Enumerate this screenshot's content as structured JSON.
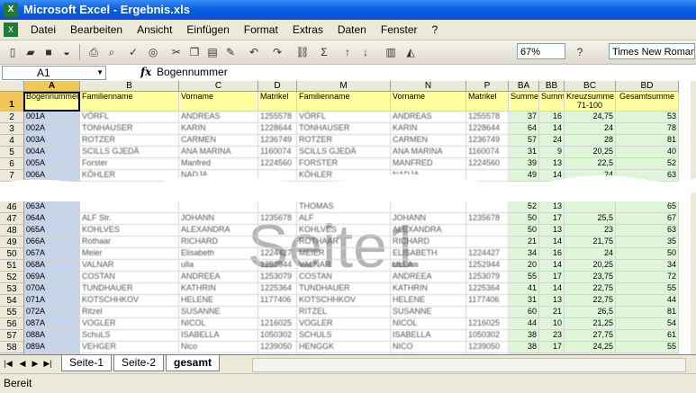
{
  "window": {
    "title": "Microsoft Excel - Ergebnis.xls"
  },
  "menu": [
    "Datei",
    "Bearbeiten",
    "Ansicht",
    "Einfügen",
    "Format",
    "Extras",
    "Daten",
    "Fenster",
    "?"
  ],
  "toolbar": {
    "zoom": "67%",
    "font": "Times New Roman"
  },
  "formula": {
    "cell_ref": "A1",
    "fx": "fx",
    "value": "Bogennummer"
  },
  "columns": [
    {
      "letter": "A",
      "w": 62
    },
    {
      "letter": "B",
      "w": 110
    },
    {
      "letter": "C",
      "w": 88
    },
    {
      "letter": "D",
      "w": 43
    },
    {
      "letter": "M",
      "w": 104
    },
    {
      "letter": "N",
      "w": 84
    },
    {
      "letter": "P",
      "w": 47
    },
    {
      "letter": "BA",
      "w": 34
    },
    {
      "letter": "BB",
      "w": 28
    },
    {
      "letter": "BC",
      "w": 57
    },
    {
      "letter": "BD",
      "w": 70
    }
  ],
  "header_row": [
    "Bogennummer",
    "Familienname",
    "Vorname",
    "Matrikel",
    "Familienname",
    "Vorname",
    "Matrikel",
    "Summe",
    "Summe",
    "Kreuzsumme 71-100",
    "Gesamtsumme"
  ],
  "rows": [
    {
      "n": "2",
      "c": [
        "001A",
        "VÖRFL",
        "ANDREAS",
        "1255578",
        "VÖRFL",
        "ANDREAS",
        "1255578",
        "37",
        "16",
        "24,75",
        "53"
      ]
    },
    {
      "n": "3",
      "c": [
        "002A",
        "TONHAUSER",
        "KARIN",
        "1228644",
        "TONHAUSER",
        "KARIN",
        "1228644",
        "64",
        "14",
        "24",
        "78"
      ]
    },
    {
      "n": "4",
      "c": [
        "003A",
        "ROTZER",
        "CARMEN",
        "1236749",
        "ROTZER",
        "CARMEN",
        "1236749",
        "57",
        "24",
        "28",
        "81"
      ]
    },
    {
      "n": "5",
      "c": [
        "004A",
        "SCILLS GJEDÄ",
        "ANA MARINA",
        "1160074",
        "SCILLS GJEDÄ",
        "ANA MARINA",
        "1160074",
        "31",
        "9",
        "20,25",
        "40"
      ]
    },
    {
      "n": "6",
      "c": [
        "005A",
        "Forster",
        "Manfred",
        "1224560",
        "FORSTER",
        "MANFRED",
        "1224560",
        "39",
        "13",
        "22,5",
        "52"
      ]
    },
    {
      "n": "7",
      "c": [
        "006A",
        "KÖHLER",
        "NADJA",
        "",
        "KÖHLER",
        "NADJA",
        "",
        "49",
        "14",
        "24",
        "63"
      ]
    },
    {
      "n": "46",
      "c": [
        "063A",
        "",
        "",
        "",
        "THOMAS",
        "",
        "",
        "52",
        "13",
        "",
        "65"
      ]
    },
    {
      "n": "47",
      "c": [
        "064A",
        "ALF Str.",
        "JOHANN",
        "1235678",
        "ALF",
        "JOHANN",
        "1235678",
        "50",
        "17",
        "25,5",
        "67"
      ]
    },
    {
      "n": "48",
      "c": [
        "065A",
        "KOHLVES",
        "ALEXANDRA",
        "",
        "KOHLVES",
        "ALEXANDRA",
        "",
        "50",
        "13",
        "23",
        "63"
      ]
    },
    {
      "n": "49",
      "c": [
        "066A",
        "Rothaar",
        "RICHARD",
        "",
        "ROTHAAR",
        "RICHARD",
        "",
        "21",
        "14",
        "21,75",
        "35"
      ]
    },
    {
      "n": "50",
      "c": [
        "067A",
        "Meier",
        "Elisabeth",
        "1224427",
        "MEIER",
        "ELISABETH",
        "1224427",
        "34",
        "16",
        "24",
        "50"
      ]
    },
    {
      "n": "51",
      "c": [
        "068A",
        "VALNAR",
        "ulla",
        "1252944",
        "VALNAR",
        "ULLA",
        "1252944",
        "20",
        "14",
        "20,25",
        "34"
      ]
    },
    {
      "n": "52",
      "c": [
        "069A",
        "COSTAN",
        "ANDREEA",
        "1253079",
        "COSTAN",
        "ANDREEA",
        "1253079",
        "55",
        "17",
        "23,75",
        "72"
      ]
    },
    {
      "n": "53",
      "c": [
        "070A",
        "TUNDHAUER",
        "KATHRIN",
        "1225364",
        "TUNDHAUER",
        "KATHRIN",
        "1225364",
        "41",
        "14",
        "22,75",
        "55"
      ]
    },
    {
      "n": "54",
      "c": [
        "071A",
        "KOTSCHHKOV",
        "HELENE",
        "1177406",
        "KOTSCHHKOV",
        "HELENE",
        "1177406",
        "31",
        "13",
        "22,75",
        "44"
      ]
    },
    {
      "n": "55",
      "c": [
        "072A",
        "Ritzel",
        "SUSANNE",
        "",
        "RITZEL",
        "SUSANNE",
        "",
        "60",
        "21",
        "26,5",
        "81"
      ]
    },
    {
      "n": "56",
      "c": [
        "087A",
        "VOGLER",
        "NICOL",
        "1216025",
        "VOGLER",
        "NICOL",
        "1216025",
        "44",
        "10",
        "21,25",
        "54"
      ]
    },
    {
      "n": "57",
      "c": [
        "088A",
        "SchuLS",
        "ISABELLA",
        "1050302",
        "SCHULS",
        "ISABELLA",
        "1050302",
        "38",
        "23",
        "27,75",
        "61"
      ]
    },
    {
      "n": "58",
      "c": [
        "089A",
        "VEHGER",
        "Nico",
        "1239050",
        "HENGGK",
        "NICO",
        "1239050",
        "38",
        "17",
        "24,25",
        "55"
      ]
    },
    {
      "n": "59",
      "c": [
        "090A",
        "PALLI",
        "RALF",
        "125558",
        "PALLI",
        "RALF",
        "125558",
        "54",
        "20",
        "27",
        "74"
      ]
    },
    {
      "n": "60",
      "c": [
        "091A",
        "JAHN",
        "MARTIN",
        "1243866",
        "JAHN",
        "MARTIN",
        "1243866",
        "53",
        "23",
        "27,5",
        "76"
      ]
    },
    {
      "n": "61",
      "c": [
        "092A",
        "HACKL",
        "TOBIAS",
        "1220950",
        "HACKL",
        "TOBIAS",
        "1220950",
        "55",
        "18",
        "25",
        "73"
      ]
    }
  ],
  "watermark": "Seite1",
  "tabs": [
    "Seite-1",
    "Seite-2",
    "gesamt"
  ],
  "status": "Bereit"
}
